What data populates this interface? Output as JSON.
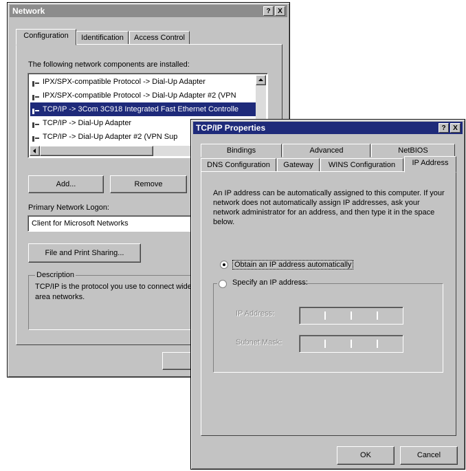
{
  "network": {
    "title": "Network",
    "help_btn": "?",
    "close_btn": "X",
    "tabs": [
      "Configuration",
      "Identification",
      "Access Control"
    ],
    "components_label": "The following network components are installed:",
    "components": [
      "IPX/SPX-compatible Protocol -> Dial-Up Adapter",
      "IPX/SPX-compatible Protocol -> Dial-Up Adapter #2 (VPN",
      "TCP/IP -> 3Com 3C918 Integrated Fast Ethernet Controlle",
      "TCP/IP -> Dial-Up Adapter",
      "TCP/IP -> Dial-Up Adapter #2 (VPN Sup"
    ],
    "selected_component_index": 2,
    "add_btn": "Add...",
    "remove_btn": "Remove",
    "logon_label": "Primary Network Logon:",
    "logon_value": "Client for Microsoft Networks",
    "file_print_btn": "File and Print Sharing...",
    "description_label": "Description",
    "description_text": "TCP/IP is the protocol you use to connect wide-area networks.",
    "ok_btn_partial": "O"
  },
  "tcpip": {
    "title": "TCP/IP Properties",
    "help_btn": "?",
    "close_btn": "X",
    "tabs_back": [
      "Bindings",
      "Advanced",
      "NetBIOS"
    ],
    "tabs_front": [
      "DNS Configuration",
      "Gateway",
      "WINS Configuration",
      "IP Address"
    ],
    "info_text": "An IP address can be automatically assigned to this computer. If your network does not automatically assign IP addresses, ask your network administrator for an address, and then type it in the space below.",
    "radio_auto": "Obtain an IP address automatically",
    "radio_specify": "Specify an IP address:",
    "ip_address_label": "IP Address:",
    "subnet_mask_label": "Subnet Mask:",
    "ok_btn": "OK",
    "cancel_btn": "Cancel"
  },
  "colors": {
    "window_bg": "#c3c3c3",
    "inactive_title": "#8c8c8c",
    "active_title": "#1e2a7a",
    "selection": "#1e2a7a"
  }
}
